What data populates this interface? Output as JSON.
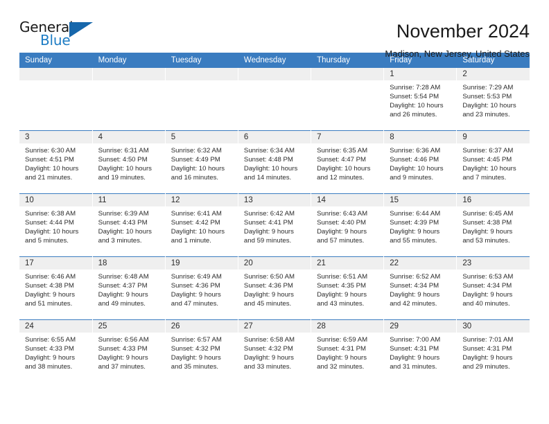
{
  "brand": {
    "name_part1": "General",
    "name_part2": "Blue",
    "accent_color": "#1d7cc4",
    "triangle_color": "#1767ab"
  },
  "header": {
    "month_title": "November 2024",
    "location": "Madison, New Jersey, United States"
  },
  "theme": {
    "header_bar_color": "#3a7cc0",
    "daynum_band_color": "#efefef",
    "text_color": "#2b2b2b"
  },
  "weekday_headers": [
    "Sunday",
    "Monday",
    "Tuesday",
    "Wednesday",
    "Thursday",
    "Friday",
    "Saturday"
  ],
  "weeks": [
    {
      "days": [
        {
          "num": "",
          "sunrise": "",
          "sunset": "",
          "daylight_line1": "",
          "daylight_line2": "",
          "empty": true
        },
        {
          "num": "",
          "sunrise": "",
          "sunset": "",
          "daylight_line1": "",
          "daylight_line2": "",
          "empty": true
        },
        {
          "num": "",
          "sunrise": "",
          "sunset": "",
          "daylight_line1": "",
          "daylight_line2": "",
          "empty": true
        },
        {
          "num": "",
          "sunrise": "",
          "sunset": "",
          "daylight_line1": "",
          "daylight_line2": "",
          "empty": true
        },
        {
          "num": "",
          "sunrise": "",
          "sunset": "",
          "daylight_line1": "",
          "daylight_line2": "",
          "empty": true
        },
        {
          "num": "1",
          "sunrise": "Sunrise: 7:28 AM",
          "sunset": "Sunset: 5:54 PM",
          "daylight_line1": "Daylight: 10 hours",
          "daylight_line2": "and 26 minutes.",
          "empty": false
        },
        {
          "num": "2",
          "sunrise": "Sunrise: 7:29 AM",
          "sunset": "Sunset: 5:53 PM",
          "daylight_line1": "Daylight: 10 hours",
          "daylight_line2": "and 23 minutes.",
          "empty": false
        }
      ]
    },
    {
      "days": [
        {
          "num": "3",
          "sunrise": "Sunrise: 6:30 AM",
          "sunset": "Sunset: 4:51 PM",
          "daylight_line1": "Daylight: 10 hours",
          "daylight_line2": "and 21 minutes.",
          "empty": false
        },
        {
          "num": "4",
          "sunrise": "Sunrise: 6:31 AM",
          "sunset": "Sunset: 4:50 PM",
          "daylight_line1": "Daylight: 10 hours",
          "daylight_line2": "and 19 minutes.",
          "empty": false
        },
        {
          "num": "5",
          "sunrise": "Sunrise: 6:32 AM",
          "sunset": "Sunset: 4:49 PM",
          "daylight_line1": "Daylight: 10 hours",
          "daylight_line2": "and 16 minutes.",
          "empty": false
        },
        {
          "num": "6",
          "sunrise": "Sunrise: 6:34 AM",
          "sunset": "Sunset: 4:48 PM",
          "daylight_line1": "Daylight: 10 hours",
          "daylight_line2": "and 14 minutes.",
          "empty": false
        },
        {
          "num": "7",
          "sunrise": "Sunrise: 6:35 AM",
          "sunset": "Sunset: 4:47 PM",
          "daylight_line1": "Daylight: 10 hours",
          "daylight_line2": "and 12 minutes.",
          "empty": false
        },
        {
          "num": "8",
          "sunrise": "Sunrise: 6:36 AM",
          "sunset": "Sunset: 4:46 PM",
          "daylight_line1": "Daylight: 10 hours",
          "daylight_line2": "and 9 minutes.",
          "empty": false
        },
        {
          "num": "9",
          "sunrise": "Sunrise: 6:37 AM",
          "sunset": "Sunset: 4:45 PM",
          "daylight_line1": "Daylight: 10 hours",
          "daylight_line2": "and 7 minutes.",
          "empty": false
        }
      ]
    },
    {
      "days": [
        {
          "num": "10",
          "sunrise": "Sunrise: 6:38 AM",
          "sunset": "Sunset: 4:44 PM",
          "daylight_line1": "Daylight: 10 hours",
          "daylight_line2": "and 5 minutes.",
          "empty": false
        },
        {
          "num": "11",
          "sunrise": "Sunrise: 6:39 AM",
          "sunset": "Sunset: 4:43 PM",
          "daylight_line1": "Daylight: 10 hours",
          "daylight_line2": "and 3 minutes.",
          "empty": false
        },
        {
          "num": "12",
          "sunrise": "Sunrise: 6:41 AM",
          "sunset": "Sunset: 4:42 PM",
          "daylight_line1": "Daylight: 10 hours",
          "daylight_line2": "and 1 minute.",
          "empty": false
        },
        {
          "num": "13",
          "sunrise": "Sunrise: 6:42 AM",
          "sunset": "Sunset: 4:41 PM",
          "daylight_line1": "Daylight: 9 hours",
          "daylight_line2": "and 59 minutes.",
          "empty": false
        },
        {
          "num": "14",
          "sunrise": "Sunrise: 6:43 AM",
          "sunset": "Sunset: 4:40 PM",
          "daylight_line1": "Daylight: 9 hours",
          "daylight_line2": "and 57 minutes.",
          "empty": false
        },
        {
          "num": "15",
          "sunrise": "Sunrise: 6:44 AM",
          "sunset": "Sunset: 4:39 PM",
          "daylight_line1": "Daylight: 9 hours",
          "daylight_line2": "and 55 minutes.",
          "empty": false
        },
        {
          "num": "16",
          "sunrise": "Sunrise: 6:45 AM",
          "sunset": "Sunset: 4:38 PM",
          "daylight_line1": "Daylight: 9 hours",
          "daylight_line2": "and 53 minutes.",
          "empty": false
        }
      ]
    },
    {
      "days": [
        {
          "num": "17",
          "sunrise": "Sunrise: 6:46 AM",
          "sunset": "Sunset: 4:38 PM",
          "daylight_line1": "Daylight: 9 hours",
          "daylight_line2": "and 51 minutes.",
          "empty": false
        },
        {
          "num": "18",
          "sunrise": "Sunrise: 6:48 AM",
          "sunset": "Sunset: 4:37 PM",
          "daylight_line1": "Daylight: 9 hours",
          "daylight_line2": "and 49 minutes.",
          "empty": false
        },
        {
          "num": "19",
          "sunrise": "Sunrise: 6:49 AM",
          "sunset": "Sunset: 4:36 PM",
          "daylight_line1": "Daylight: 9 hours",
          "daylight_line2": "and 47 minutes.",
          "empty": false
        },
        {
          "num": "20",
          "sunrise": "Sunrise: 6:50 AM",
          "sunset": "Sunset: 4:36 PM",
          "daylight_line1": "Daylight: 9 hours",
          "daylight_line2": "and 45 minutes.",
          "empty": false
        },
        {
          "num": "21",
          "sunrise": "Sunrise: 6:51 AM",
          "sunset": "Sunset: 4:35 PM",
          "daylight_line1": "Daylight: 9 hours",
          "daylight_line2": "and 43 minutes.",
          "empty": false
        },
        {
          "num": "22",
          "sunrise": "Sunrise: 6:52 AM",
          "sunset": "Sunset: 4:34 PM",
          "daylight_line1": "Daylight: 9 hours",
          "daylight_line2": "and 42 minutes.",
          "empty": false
        },
        {
          "num": "23",
          "sunrise": "Sunrise: 6:53 AM",
          "sunset": "Sunset: 4:34 PM",
          "daylight_line1": "Daylight: 9 hours",
          "daylight_line2": "and 40 minutes.",
          "empty": false
        }
      ]
    },
    {
      "days": [
        {
          "num": "24",
          "sunrise": "Sunrise: 6:55 AM",
          "sunset": "Sunset: 4:33 PM",
          "daylight_line1": "Daylight: 9 hours",
          "daylight_line2": "and 38 minutes.",
          "empty": false
        },
        {
          "num": "25",
          "sunrise": "Sunrise: 6:56 AM",
          "sunset": "Sunset: 4:33 PM",
          "daylight_line1": "Daylight: 9 hours",
          "daylight_line2": "and 37 minutes.",
          "empty": false
        },
        {
          "num": "26",
          "sunrise": "Sunrise: 6:57 AM",
          "sunset": "Sunset: 4:32 PM",
          "daylight_line1": "Daylight: 9 hours",
          "daylight_line2": "and 35 minutes.",
          "empty": false
        },
        {
          "num": "27",
          "sunrise": "Sunrise: 6:58 AM",
          "sunset": "Sunset: 4:32 PM",
          "daylight_line1": "Daylight: 9 hours",
          "daylight_line2": "and 33 minutes.",
          "empty": false
        },
        {
          "num": "28",
          "sunrise": "Sunrise: 6:59 AM",
          "sunset": "Sunset: 4:31 PM",
          "daylight_line1": "Daylight: 9 hours",
          "daylight_line2": "and 32 minutes.",
          "empty": false
        },
        {
          "num": "29",
          "sunrise": "Sunrise: 7:00 AM",
          "sunset": "Sunset: 4:31 PM",
          "daylight_line1": "Daylight: 9 hours",
          "daylight_line2": "and 31 minutes.",
          "empty": false
        },
        {
          "num": "30",
          "sunrise": "Sunrise: 7:01 AM",
          "sunset": "Sunset: 4:31 PM",
          "daylight_line1": "Daylight: 9 hours",
          "daylight_line2": "and 29 minutes.",
          "empty": false
        }
      ]
    }
  ]
}
